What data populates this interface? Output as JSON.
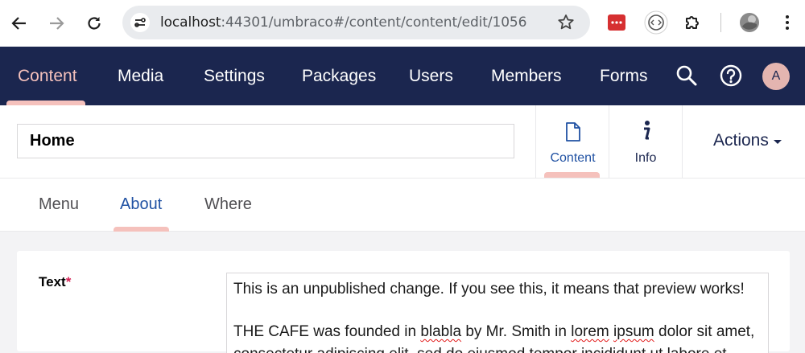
{
  "browser": {
    "url_host": "localhost",
    "url_rest": ":44301/umbraco#/content/content/edit/1056"
  },
  "nav": {
    "items": [
      {
        "label": "Content"
      },
      {
        "label": "Media"
      },
      {
        "label": "Settings"
      },
      {
        "label": "Packages"
      },
      {
        "label": "Users"
      },
      {
        "label": "Members"
      },
      {
        "label": "Forms"
      }
    ],
    "active": "Content",
    "avatar_initial": "A"
  },
  "editor": {
    "node_name": "Home",
    "apps": [
      {
        "label": "Content"
      },
      {
        "label": "Info"
      }
    ],
    "actions_label": "Actions"
  },
  "tabs": {
    "items": [
      {
        "label": "Menu"
      },
      {
        "label": "About"
      },
      {
        "label": "Where"
      }
    ],
    "active": "About"
  },
  "property": {
    "label": "Text",
    "required_marker": "*",
    "line1": "This is an unpublished change. If you see this, it means that preview works!",
    "line2_a": "THE CAFE was founded in ",
    "line2_sp1": "blabla",
    "line2_b": " by Mr. Smith in ",
    "line2_sp2": "lorem",
    "line2_c": " ",
    "line2_sp3": "ipsum",
    "line2_d": " dolor sit amet,",
    "line3": "consectetur adipiscing elit, sed do eiusmod tempor incididunt ut labore et"
  },
  "colors": {
    "header_bg": "#1b264f",
    "accent_pink": "#f5c1bc",
    "active_tab_text": "#2152a3",
    "required": "#d42054"
  }
}
